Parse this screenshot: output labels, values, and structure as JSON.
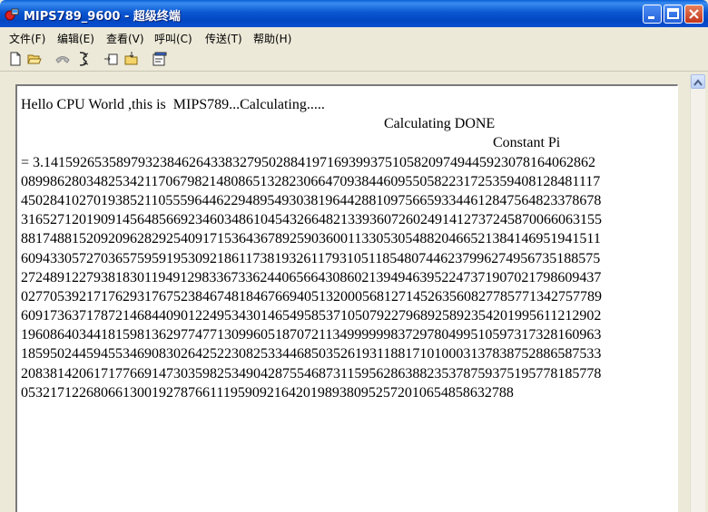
{
  "window": {
    "title": "MIPS789_9600 - 超级终端"
  },
  "menu": [
    {
      "label": "文件(F)"
    },
    {
      "label": "编辑(E)"
    },
    {
      "label": "查看(V)"
    },
    {
      "label": "呼叫(C)"
    },
    {
      "label": "传送(T)"
    },
    {
      "label": "帮助(H)"
    }
  ],
  "toolbar": {
    "icons": [
      "new-icon",
      "open-icon",
      "disconnect-phone-icon",
      "dial-icon",
      "send-icon",
      "receive-icon",
      "properties-icon"
    ]
  },
  "terminal": {
    "lines": [
      "Hello CPU World ,this is  MIPS789...Calculating.....",
      "                                                                                                    Calculating DONE",
      "                                                                                                                                  Constant Pi",
      "= 3.1415926535897932384626433832795028841971693993751058209749445923078164062862",
      "08998628034825342117067982148086513282306647093844609550582231725359408128481117",
      "45028410270193852110555964462294895493038196442881097566593344612847564823378678",
      "31652712019091456485669234603486104543266482133936072602491412737245870066063155",
      "88174881520920962829254091715364367892590360011330530548820466521384146951941511",
      "60943305727036575959195309218611738193261179310511854807446237996274956735188575",
      "27248912279381830119491298336733624406566430860213949463952247371907021798609437",
      "02770539217176293176752384674818467669405132000568127145263560827785771342757789",
      "60917363717872146844090122495343014654958537105079227968925892354201995611212902",
      "19608640344181598136297747713099605187072113499999983729780499510597317328160963",
      "18595024459455346908302642522308253344685035261931188171010003137838752886587533",
      "20838142061717766914730359825349042875546873115956286388235378759375195778185778",
      "0532171226806613001927876611195909216420198938095257201065485863278​8"
    ]
  },
  "colors": {
    "titlebar": "#0b58d2",
    "face": "#ece9d8",
    "terminal_bg": "#ffffff",
    "terminal_fg": "#000000"
  }
}
